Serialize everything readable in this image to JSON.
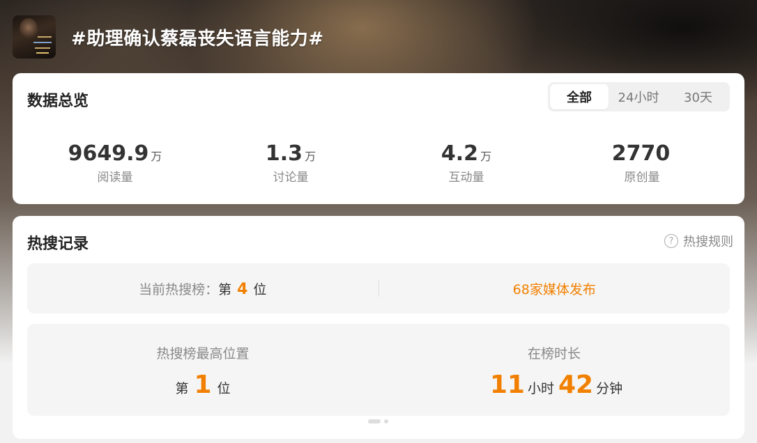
{
  "header": {
    "title": "#助理确认蔡磊丧失语言能力#"
  },
  "overview": {
    "title": "数据总览",
    "tabs": [
      {
        "label": "全部",
        "active": true
      },
      {
        "label": "24小时",
        "active": false
      },
      {
        "label": "30天",
        "active": false
      }
    ],
    "stats": [
      {
        "value": "9649.9",
        "unit": "万",
        "label": "阅读量"
      },
      {
        "value": "1.3",
        "unit": "万",
        "label": "讨论量"
      },
      {
        "value": "4.2",
        "unit": "万",
        "label": "互动量"
      },
      {
        "value": "2770",
        "unit": "",
        "label": "原创量"
      }
    ]
  },
  "hot": {
    "title": "热搜记录",
    "rules_label": "热搜规则",
    "current_rank_label": "当前热搜榜：",
    "rank_prefix": "第",
    "current_rank": "4",
    "rank_suffix": "位",
    "media_text": "68家媒体发布",
    "highest_label": "热搜榜最高位置",
    "highest_rank": "1",
    "duration_label": "在榜时长",
    "duration_hours": "11",
    "hours_unit": "小时",
    "duration_minutes": "42",
    "minutes_unit": "分钟"
  },
  "colors": {
    "accent": "#f28000",
    "card_bg": "#ffffff",
    "panel_bg": "#f5f5f5"
  }
}
